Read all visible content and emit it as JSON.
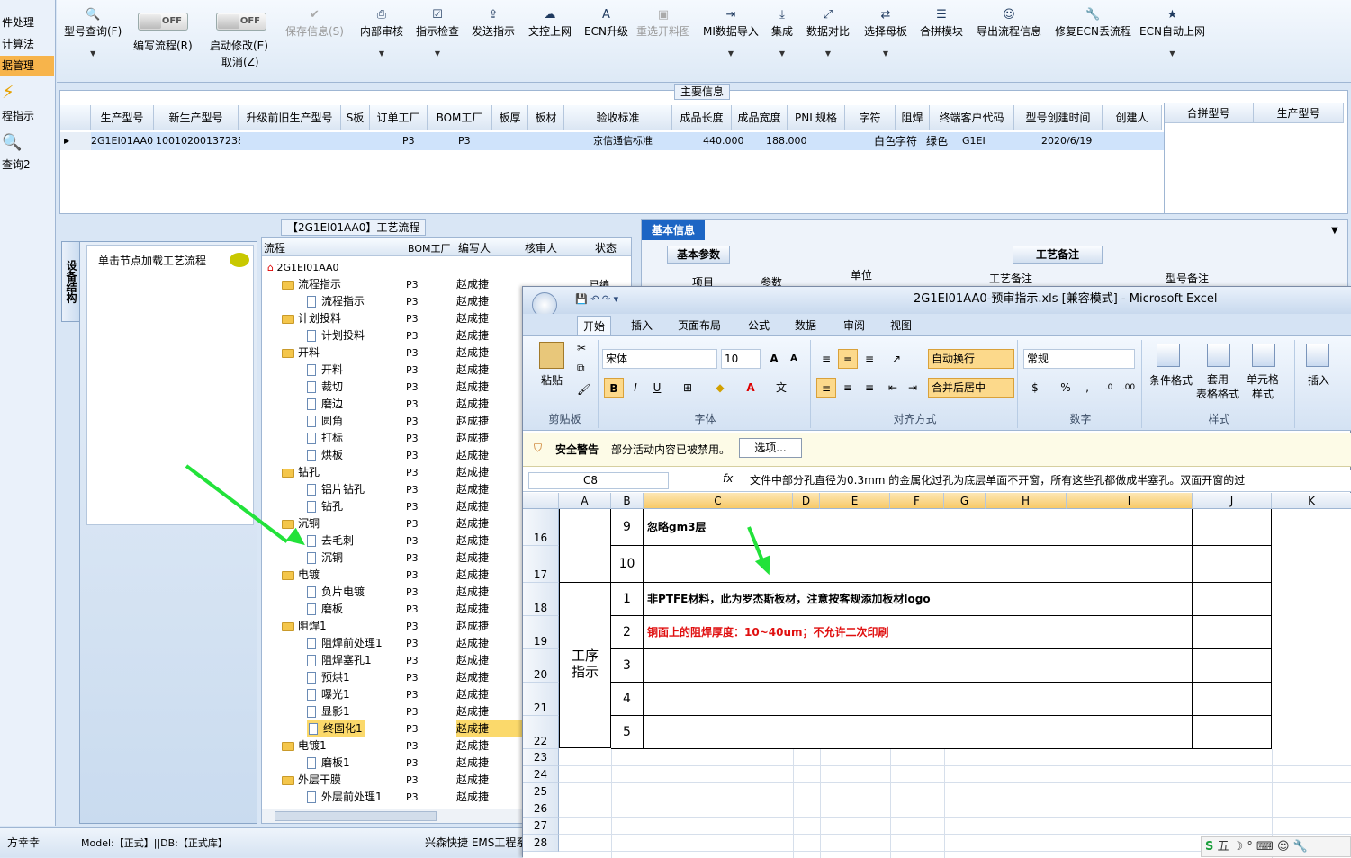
{
  "sidebar": {
    "items": [
      "件处理",
      "计算法",
      "据管理",
      "程指示",
      "查询2"
    ]
  },
  "toolbar": {
    "items": [
      {
        "icon": "search-icon",
        "label": "型号查询(F)"
      },
      {
        "icon": "toggle",
        "label": "编写流程(R)",
        "state": "OFF"
      },
      {
        "icon": "toggle",
        "label": "启动修改(E)",
        "state": "OFF",
        "sub": "取消(Z)"
      },
      {
        "icon": "check-icon",
        "label": "保存信息(S)",
        "disabled": true
      },
      {
        "icon": "printer-icon",
        "label": "内部审核"
      },
      {
        "icon": "check-icon",
        "label": "指示检查"
      },
      {
        "icon": "upload-icon",
        "label": "发送指示"
      },
      {
        "icon": "cloud-upload-icon",
        "label": "文控上网"
      },
      {
        "icon": "ecn-icon",
        "label": "ECN升级"
      },
      {
        "icon": "image-icon",
        "label": "重选开料图",
        "disabled": true
      },
      {
        "icon": "import-icon",
        "label": "MI数据导入"
      },
      {
        "icon": "download-icon",
        "label": "集成"
      },
      {
        "icon": "compare-icon",
        "label": "数据对比"
      },
      {
        "icon": "shuffle-icon",
        "label": "选择母板"
      },
      {
        "icon": "list-icon",
        "label": "合拼模块"
      },
      {
        "icon": "smile-icon",
        "label": "导出流程信息"
      },
      {
        "icon": "wrench-icon",
        "label": "修复ECN丢流程"
      },
      {
        "icon": "star-icon",
        "label": "ECN自动上网"
      }
    ]
  },
  "main_info": {
    "title": "主要信息",
    "columns": [
      "生产型号",
      "新生产型号",
      "升级前旧生产型号",
      "S板",
      "订单工厂",
      "BOM工厂",
      "板厚",
      "板材",
      "验收标准",
      "成品长度",
      "成品宽度",
      "PNL规格",
      "字符",
      "阻焊",
      "终端客户代码",
      "型号创建时间",
      "创建人"
    ],
    "row": [
      "2G1EI01AA0",
      "10010200137238",
      "",
      "",
      "P3",
      "P3",
      "",
      "",
      "京信通信标准",
      "440.000",
      "188.000",
      "",
      "白色字符",
      "绿色",
      "G1EI",
      "2020/6/19",
      ""
    ],
    "right_columns": [
      "合拼型号",
      "生产型号"
    ]
  },
  "process": {
    "title": "【2G1EI01AA0】工艺流程",
    "side_tab": "设备结构",
    "node_hint": "单击节点加载工艺流程",
    "columns": [
      "流程",
      "BOM工厂",
      "编写人",
      "核审人",
      "状态"
    ],
    "root": "2G1EI01AA0",
    "state_fragment": "已编",
    "rows": [
      {
        "name": "流程指示",
        "type": "folder",
        "level": 1,
        "bom": "P3",
        "by": "赵成捷"
      },
      {
        "name": "流程指示",
        "type": "doc",
        "level": 2,
        "bom": "P3",
        "by": "赵成捷"
      },
      {
        "name": "计划投料",
        "type": "folder",
        "level": 1,
        "bom": "P3",
        "by": "赵成捷"
      },
      {
        "name": "计划投料",
        "type": "doc",
        "level": 2,
        "bom": "P3",
        "by": "赵成捷"
      },
      {
        "name": "开料",
        "type": "folder",
        "level": 1,
        "bom": "P3",
        "by": "赵成捷"
      },
      {
        "name": "开料",
        "type": "doc",
        "level": 2,
        "bom": "P3",
        "by": "赵成捷"
      },
      {
        "name": "裁切",
        "type": "doc",
        "level": 2,
        "bom": "P3",
        "by": "赵成捷"
      },
      {
        "name": "磨边",
        "type": "doc",
        "level": 2,
        "bom": "P3",
        "by": "赵成捷"
      },
      {
        "name": "圆角",
        "type": "doc",
        "level": 2,
        "bom": "P3",
        "by": "赵成捷"
      },
      {
        "name": "打标",
        "type": "doc",
        "level": 2,
        "bom": "P3",
        "by": "赵成捷"
      },
      {
        "name": "烘板",
        "type": "doc",
        "level": 2,
        "bom": "P3",
        "by": "赵成捷"
      },
      {
        "name": "钻孔",
        "type": "folder",
        "level": 1,
        "bom": "P3",
        "by": "赵成捷"
      },
      {
        "name": "铝片钻孔",
        "type": "doc",
        "level": 2,
        "bom": "P3",
        "by": "赵成捷"
      },
      {
        "name": "钻孔",
        "type": "doc",
        "level": 2,
        "bom": "P3",
        "by": "赵成捷"
      },
      {
        "name": "沉铜",
        "type": "folder",
        "level": 1,
        "bom": "P3",
        "by": "赵成捷"
      },
      {
        "name": "去毛刺",
        "type": "doc",
        "level": 2,
        "bom": "P3",
        "by": "赵成捷"
      },
      {
        "name": "沉铜",
        "type": "doc",
        "level": 2,
        "bom": "P3",
        "by": "赵成捷"
      },
      {
        "name": "电镀",
        "type": "folder",
        "level": 1,
        "bom": "P3",
        "by": "赵成捷"
      },
      {
        "name": "负片电镀",
        "type": "doc",
        "level": 2,
        "bom": "P3",
        "by": "赵成捷"
      },
      {
        "name": "磨板",
        "type": "doc",
        "level": 2,
        "bom": "P3",
        "by": "赵成捷"
      },
      {
        "name": "阻焊1",
        "type": "folder",
        "level": 1,
        "bom": "P3",
        "by": "赵成捷"
      },
      {
        "name": "阻焊前处理1",
        "type": "doc",
        "level": 2,
        "bom": "P3",
        "by": "赵成捷"
      },
      {
        "name": "阻焊塞孔1",
        "type": "doc",
        "level": 2,
        "bom": "P3",
        "by": "赵成捷"
      },
      {
        "name": "预烘1",
        "type": "doc",
        "level": 2,
        "bom": "P3",
        "by": "赵成捷"
      },
      {
        "name": "曝光1",
        "type": "doc",
        "level": 2,
        "bom": "P3",
        "by": "赵成捷"
      },
      {
        "name": "显影1",
        "type": "doc",
        "level": 2,
        "bom": "P3",
        "by": "赵成捷"
      },
      {
        "name": "终固化1",
        "type": "doc",
        "level": 2,
        "bom": "P3",
        "by": "赵成捷",
        "selected": true
      },
      {
        "name": "电镀1",
        "type": "folder",
        "level": 1,
        "bom": "P3",
        "by": "赵成捷"
      },
      {
        "name": "磨板1",
        "type": "doc",
        "level": 2,
        "bom": "P3",
        "by": "赵成捷"
      },
      {
        "name": "外层干膜",
        "type": "folder",
        "level": 1,
        "bom": "P3",
        "by": "赵成捷"
      },
      {
        "name": "外层前处理1",
        "type": "doc",
        "level": 2,
        "bom": "P3",
        "by": "赵成捷"
      }
    ]
  },
  "right_info": {
    "tab": "基本信息",
    "sub_tab": "基本参数",
    "cols": [
      "项目",
      "参数",
      "单位"
    ],
    "craft_tab": "工艺备注",
    "craft_cols": [
      "工艺备注",
      "型号备注"
    ]
  },
  "status": {
    "user": "方幸幸",
    "model": "Model:【正式】||DB:【正式库】",
    "company": "兴森快捷 EMS工程系"
  },
  "excel": {
    "title": "2G1EI01AA0-预审指示.xls  [兼容模式] - Microsoft Excel",
    "tabs": [
      "开始",
      "插入",
      "页面布局",
      "公式",
      "数据",
      "审阅",
      "视图"
    ],
    "font_name": "宋体",
    "font_size": "10",
    "number_format": "常规",
    "wrap_text": "自动换行",
    "merge_center": "合并后居中",
    "groups": [
      "剪贴板",
      "字体",
      "对齐方式",
      "数字",
      "样式"
    ],
    "buttons": {
      "paste": "粘贴",
      "cond_format": "条件格式",
      "table_format": "套用\n表格格式",
      "cell_style": "单元格\n样式",
      "insert": "插入"
    },
    "security_title": "安全警告",
    "security_text": "部分活动内容已被禁用。",
    "options_btn": "选项...",
    "name_box": "C8",
    "formula": "文件中部分孔直径为0.3mm 的金属化过孔为底层单面不开窗，所有这些孔都做成半塞孔。双面开窗的过",
    "columns": [
      "A",
      "B",
      "C",
      "D",
      "E",
      "F",
      "G",
      "H",
      "I",
      "J",
      "K"
    ],
    "rows": [
      {
        "num": "16",
        "b": "9",
        "c": "忽略gm3层",
        "red": false
      },
      {
        "num": "17",
        "b": "10",
        "c": "",
        "red": false
      },
      {
        "num": "18",
        "b": "1",
        "c": "非PTFE材料，此为罗杰斯板材，注意按客规添加板材logo",
        "red": false
      },
      {
        "num": "19",
        "b": "2",
        "c": "铜面上的阻焊厚度：10~40um；不允许二次印刷",
        "red": true
      },
      {
        "num": "20",
        "b": "3",
        "c": "",
        "red": false
      },
      {
        "num": "21",
        "b": "4",
        "c": "",
        "red": false
      },
      {
        "num": "22",
        "b": "5",
        "c": "",
        "red": false
      }
    ],
    "merged_a": "工序\n指示",
    "empty_rows": [
      "23",
      "24",
      "25",
      "26",
      "27",
      "28"
    ]
  },
  "colors": {
    "accent": "#1c65c4",
    "selected": "#fbd96b",
    "arrow": "#22e23a",
    "red_text": "#e01010"
  }
}
